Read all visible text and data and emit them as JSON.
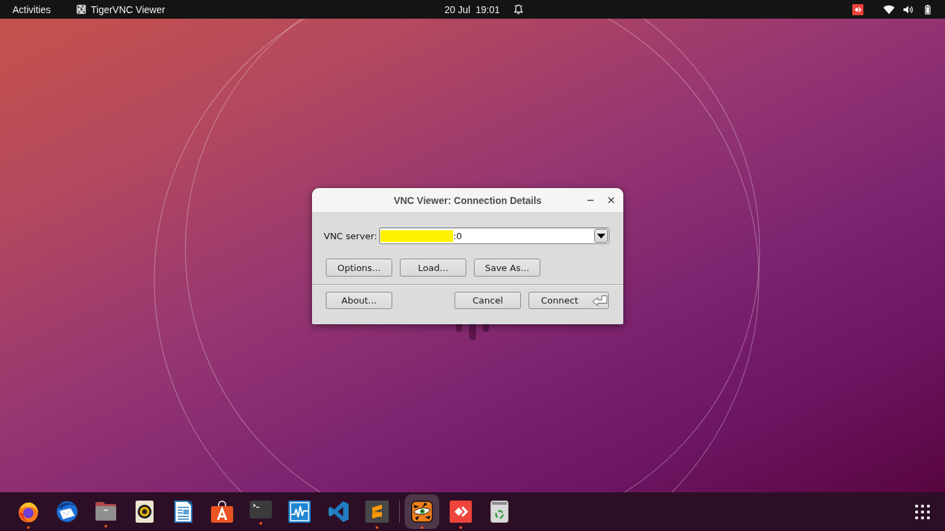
{
  "top_bar": {
    "activities": "Activities",
    "app_menu": "TigerVNC Viewer",
    "clock": "20 Jul  19:01"
  },
  "dialog": {
    "title": "VNC Viewer: Connection Details",
    "server": {
      "label": "VNC server:",
      "value": ":0",
      "redacted": true
    },
    "action_buttons": [
      {
        "label": "Options..."
      },
      {
        "label": "Load..."
      },
      {
        "label": "Save As..."
      }
    ],
    "footer_left": [
      {
        "label": "About...",
        "default": false
      }
    ],
    "footer_right": [
      {
        "label": "Cancel",
        "default": false
      },
      {
        "label": "Connect",
        "default": true
      }
    ]
  },
  "dock": {
    "favorites": [
      {
        "running": true,
        "selected": false
      },
      {
        "running": false,
        "selected": false
      },
      {
        "running": true,
        "selected": false
      },
      {
        "running": false,
        "selected": false
      },
      {
        "running": false,
        "selected": false
      },
      {
        "running": false,
        "selected": false
      },
      {
        "running": true,
        "selected": false
      },
      {
        "running": false,
        "selected": false
      },
      {
        "running": false,
        "selected": false
      },
      {
        "running": true,
        "selected": false
      }
    ],
    "others": [
      {
        "running": true,
        "selected": true
      },
      {
        "running": true,
        "selected": false
      },
      {
        "running": false,
        "selected": false
      }
    ]
  }
}
